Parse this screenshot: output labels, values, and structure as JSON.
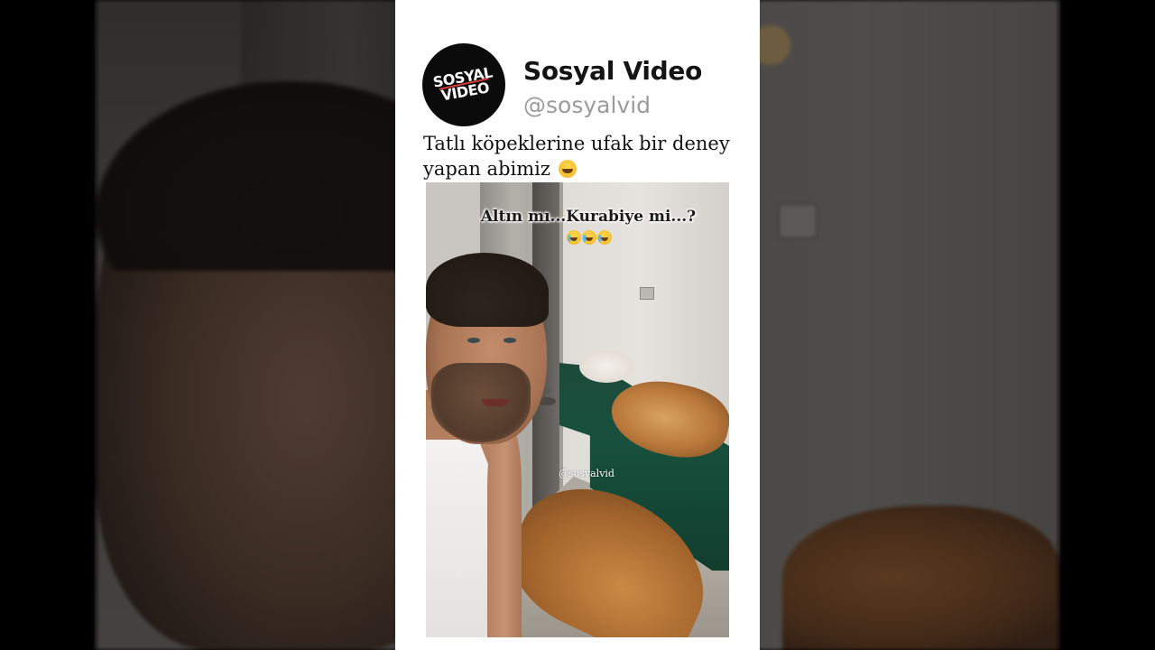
{
  "post": {
    "display_name": "Sosyal Video",
    "handle": "@sosyalvid",
    "text": "Tatlı köpeklerine ufak bir deney yapan abimiz",
    "text_emoji": "grinning-face-emoji",
    "avatar_logo_text": "SOSYAL VIDEO"
  },
  "video": {
    "caption": "Altın mı...Kurabiye mi...?",
    "caption_emoji": "face-with-tears-of-joy-emoji",
    "caption_emoji_count": 3,
    "watermark": "@sosyalvid"
  },
  "colors": {
    "card_bg": "#ffffff",
    "name_color": "#141414",
    "handle_color": "#9a9a9a",
    "sofa_green": "#17503d"
  }
}
